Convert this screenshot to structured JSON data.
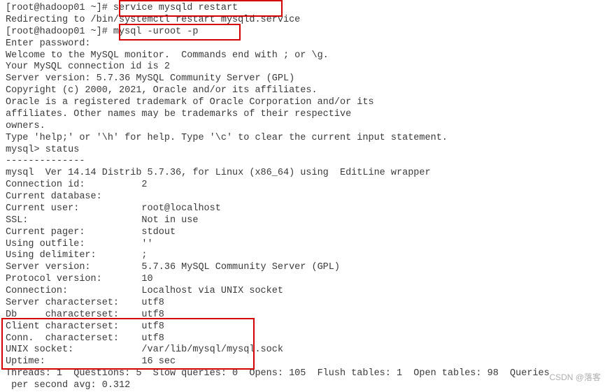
{
  "lines": {
    "l01": "[root@hadoop01 ~]# service mysqld restart",
    "l02": "Redirecting to /bin/systemctl restart mysqld.service",
    "l03": "[root@hadoop01 ~]# mysql -uroot -p",
    "l04": "Enter password: ",
    "l05": "Welcome to the MySQL monitor.  Commands end with ; or \\g.",
    "l06": "Your MySQL connection id is 2",
    "l07": "Server version: 5.7.36 MySQL Community Server (GPL)",
    "l08": "",
    "l09": "Copyright (c) 2000, 2021, Oracle and/or its affiliates.",
    "l10": "",
    "l11": "Oracle is a registered trademark of Oracle Corporation and/or its",
    "l12": "affiliates. Other names may be trademarks of their respective",
    "l13": "owners.",
    "l14": "",
    "l15": "Type 'help;' or '\\h' for help. Type '\\c' to clear the current input statement.",
    "l16": "",
    "l17": "mysql> status",
    "l18": "--------------",
    "l19": "mysql  Ver 14.14 Distrib 5.7.36, for Linux (x86_64) using  EditLine wrapper",
    "l20": "",
    "l21": "Connection id:          2",
    "l22": "Current database:       ",
    "l23": "Current user:           root@localhost",
    "l24": "SSL:                    Not in use",
    "l25": "Current pager:          stdout",
    "l26": "Using outfile:          ''",
    "l27": "Using delimiter:        ;",
    "l28": "Server version:         5.7.36 MySQL Community Server (GPL)",
    "l29": "Protocol version:       10",
    "l30": "Connection:             Localhost via UNIX socket",
    "l31": "Server characterset:    utf8",
    "l32": "Db     characterset:    utf8",
    "l33": "Client characterset:    utf8",
    "l34": "Conn.  characterset:    utf8",
    "l35": "UNIX socket:            /var/lib/mysql/mysql.sock",
    "l36": "Uptime:                 16 sec",
    "l37": "",
    "l38": "Threads: 1  Questions: 5  Slow queries: 0  Opens: 105  Flush tables: 1  Open tables: 98  Queries",
    "l39": " per second avg: 0.312"
  },
  "watermark": "CSDN @落客"
}
